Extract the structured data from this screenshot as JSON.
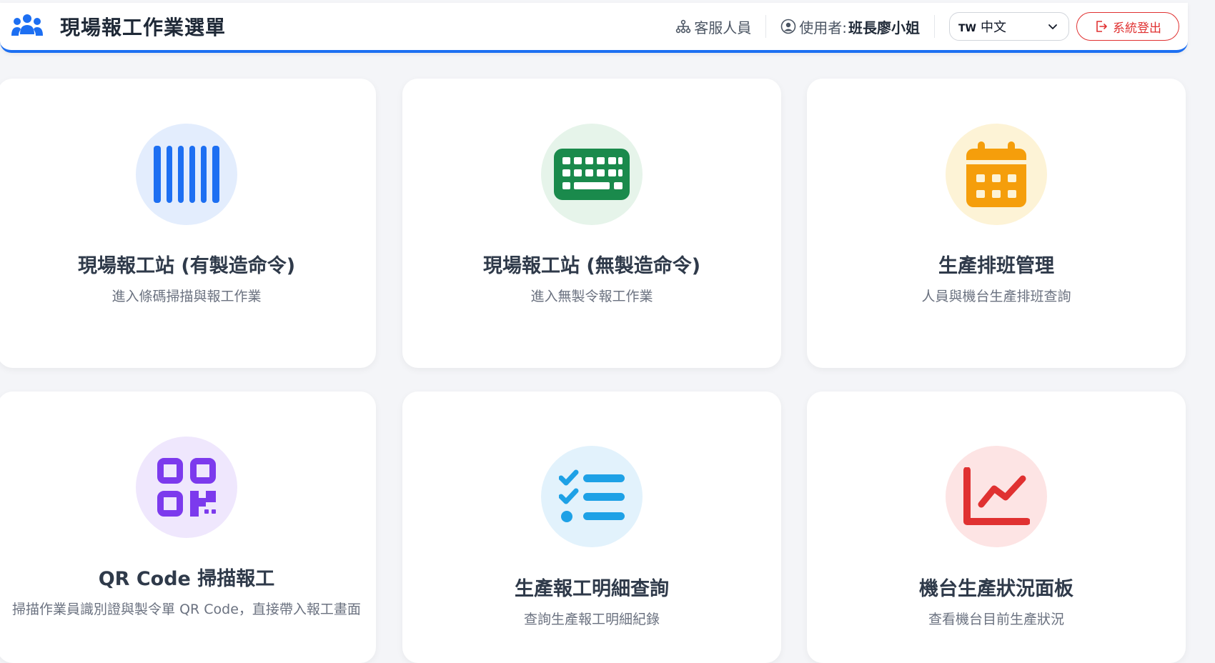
{
  "header": {
    "title": "現場報工作業選單",
    "brand_icon": "people-group-icon",
    "support_label": "客服人員",
    "user_prefix": "使用者:",
    "user_name": "班長廖小姐",
    "language": {
      "flag": "TW",
      "selected": "中文"
    },
    "logout_label": "系統登出",
    "accent_color": "#1d6ff2",
    "logout_color": "#e03131"
  },
  "cards": [
    {
      "title": "現場報工站 (有製造命令)",
      "description": "進入條碼掃描與報工作業",
      "icon": "barcode-icon",
      "icon_color": "#1d6ff2",
      "bg_color": "#e3edfd"
    },
    {
      "title": "現場報工站 (無製造命令)",
      "description": "進入無製令報工作業",
      "icon": "keyboard-icon",
      "icon_color": "#1a8a4c",
      "bg_color": "#e6f4ea"
    },
    {
      "title": "生產排班管理",
      "description": "人員與機台生產排班查詢",
      "icon": "calendar-icon",
      "icon_color": "#f59e0b",
      "bg_color": "#fdf3d6"
    },
    {
      "title": "QR Code 掃描報工",
      "description": "掃描作業員識別證與製令單 QR Code，直接帶入報工畫面",
      "icon": "qr-code-icon",
      "icon_color": "#7c3aed",
      "bg_color": "#efe7fd"
    },
    {
      "title": "生產報工明細查詢",
      "description": "查詢生產報工明細紀錄",
      "icon": "checklist-icon",
      "icon_color": "#1ea1e6",
      "bg_color": "#e2f2fc"
    },
    {
      "title": "機台生產狀況面板",
      "description": "查看機台目前生產狀況",
      "icon": "line-chart-icon",
      "icon_color": "#e03131",
      "bg_color": "#fde4e4"
    }
  ]
}
